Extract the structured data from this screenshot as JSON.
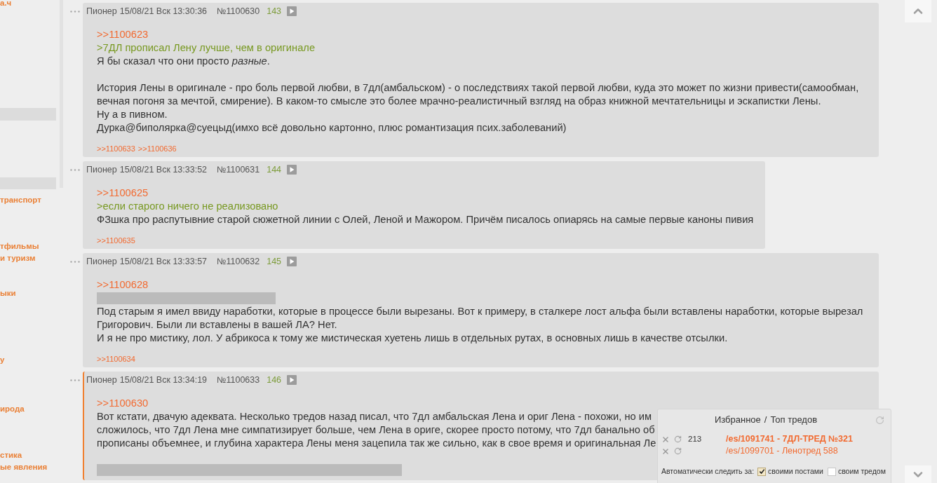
{
  "sidebar": {
    "pinned": [
      {
        "kind": "link",
        "label": "а.ч"
      },
      {
        "kind": "bar"
      },
      {
        "kind": "bar"
      }
    ],
    "boards": [
      "транспорт",
      "тфильмы",
      "и туризм",
      "ыки",
      "у",
      "ирода",
      "стика",
      "ые явления"
    ]
  },
  "posts": [
    {
      "author": "Пионер",
      "date": "15/08/21 Вск 13:30:36",
      "number": "№1100630",
      "index": "143",
      "highlighted": false,
      "body": [
        {
          "kind": "reply",
          "text": ">>1100623"
        },
        {
          "kind": "quote",
          "text": ">7ДЛ прописал Лену лучше, чем в оригинале"
        },
        {
          "kind": "text",
          "text": "Я бы сказал что они просто *разные*."
        },
        {
          "kind": "blank"
        },
        {
          "kind": "text",
          "text": "История Лены в оригинале - про боль первой любви, в 7дл(амбальском) - о последствиях такой первой любви, куда это может по жизни привести(самообман, вечная погоня за мечтой, смирение). В каком-то смысле это более мрачно-реалистичный взгляд на образ книжной мечтательницы и эскапистки Лены."
        },
        {
          "kind": "text",
          "text": "Ну а в пивном."
        },
        {
          "kind": "text",
          "text": "Дурка@биполярка@суецыд(имхо всё довольно картонно, плюс романтизация псих.заболеваний)"
        }
      ],
      "replies": [
        ">>1100633",
        ">>1100636"
      ]
    },
    {
      "author": "Пионер",
      "date": "15/08/21 Вск 13:33:52",
      "number": "№1100631",
      "index": "144",
      "highlighted": false,
      "body": [
        {
          "kind": "reply",
          "text": ">>1100625"
        },
        {
          "kind": "quote",
          "text": ">если старого ничего не реализовано"
        },
        {
          "kind": "text",
          "text": "ФЗшка про распутывние старой сюжетной линии с Олей, Леной и Мажором. Причём писалось опиарясь на самые первые каноны пивия"
        }
      ],
      "replies": [
        ">>1100635"
      ]
    },
    {
      "author": "Пионер",
      "date": "15/08/21 Вск 13:33:57",
      "number": "№1100632",
      "index": "145",
      "highlighted": false,
      "body": [
        {
          "kind": "reply",
          "text": ">>1100628"
        },
        {
          "kind": "spoiler"
        },
        {
          "kind": "text",
          "text": "Под старым я имел ввиду наработки, которые в процессе были вырезаны. Вот к примеру, в сталкере лост альфа были вставлены наработки, которые вырезал Григорович. Были ли вставлены в вашей ЛА? Нет."
        },
        {
          "kind": "text",
          "text": "И я не про мистику, лол. У абрикоса к тому же мистическая хуетень лишь в отдельных рутах, в основных лишь в качестве отсылки."
        }
      ],
      "replies": [
        ">>1100634"
      ]
    },
    {
      "author": "Пионер",
      "date": "15/08/21 Вск 13:34:19",
      "number": "№1100633",
      "index": "146",
      "highlighted": true,
      "body": [
        {
          "kind": "reply",
          "text": ">>1100630"
        },
        {
          "kind": "text",
          "text": "Вот кстати, двачую адеквата. Несколько тредов назад писал, что 7дл амбальская Лена и ориг Лена - похожи, но им"
        },
        {
          "kind": "text",
          "text": "сложилось, что 7дл Лена мне симпатизирует больше, чем Лена в ориге, скорее просто потому, что 7дл банально об"
        },
        {
          "kind": "text",
          "text": "прописаны объемнее, и глубина характера Лены меня зацепила так же сильно, как в свое время и оригинальная Ле"
        },
        {
          "kind": "blank"
        },
        {
          "kind": "spoiler"
        }
      ]
    }
  ],
  "favorites_panel": {
    "tabs": [
      "Избранное",
      "Топ тредов"
    ],
    "separator": "/",
    "threads": [
      {
        "count": "213",
        "link": "/es/1091741 - 7ДЛ-ТРЕД №321",
        "unread": true
      },
      {
        "link": "/es/1099701 - Ленотред 588",
        "unread": false
      }
    ],
    "auto_watch": {
      "label": "Автоматически следить за:",
      "options": [
        {
          "label": "своими постами",
          "checked": true
        },
        {
          "label": "своим тредом",
          "checked": false
        }
      ]
    }
  }
}
